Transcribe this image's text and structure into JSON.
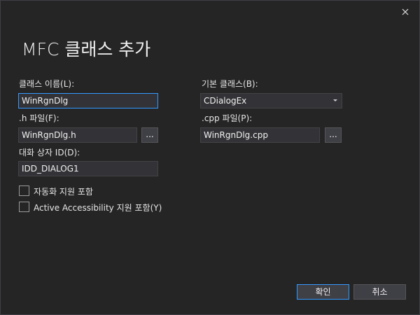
{
  "dialog": {
    "title": "MFC 클래스 추가",
    "close_icon": "close-icon"
  },
  "class_name": {
    "label": "클래스 이름(L):",
    "value": "WinRgnDlg"
  },
  "base_class": {
    "label": "기본 클래스(B):",
    "value": "CDialogEx",
    "icon": "chevron-down-icon"
  },
  "h_file": {
    "label": ".h 파일(F):",
    "value": "WinRgnDlg.h",
    "browse_label": "..."
  },
  "cpp_file": {
    "label": ".cpp 파일(P):",
    "value": "WinRgnDlg.cpp",
    "browse_label": "..."
  },
  "dialog_id": {
    "label": "대화 상자 ID(D):",
    "value": "IDD_DIALOG1"
  },
  "options": {
    "automation": {
      "label": "자동화 지원 포함",
      "checked": false
    },
    "accessibility": {
      "label": "Active Accessibility 지원 포함(Y)",
      "checked": false
    }
  },
  "buttons": {
    "ok": "확인",
    "cancel": "취소"
  },
  "colors": {
    "background": "#252526",
    "field": "#333337",
    "focus": "#3399ff",
    "button": "#3f3f46"
  }
}
